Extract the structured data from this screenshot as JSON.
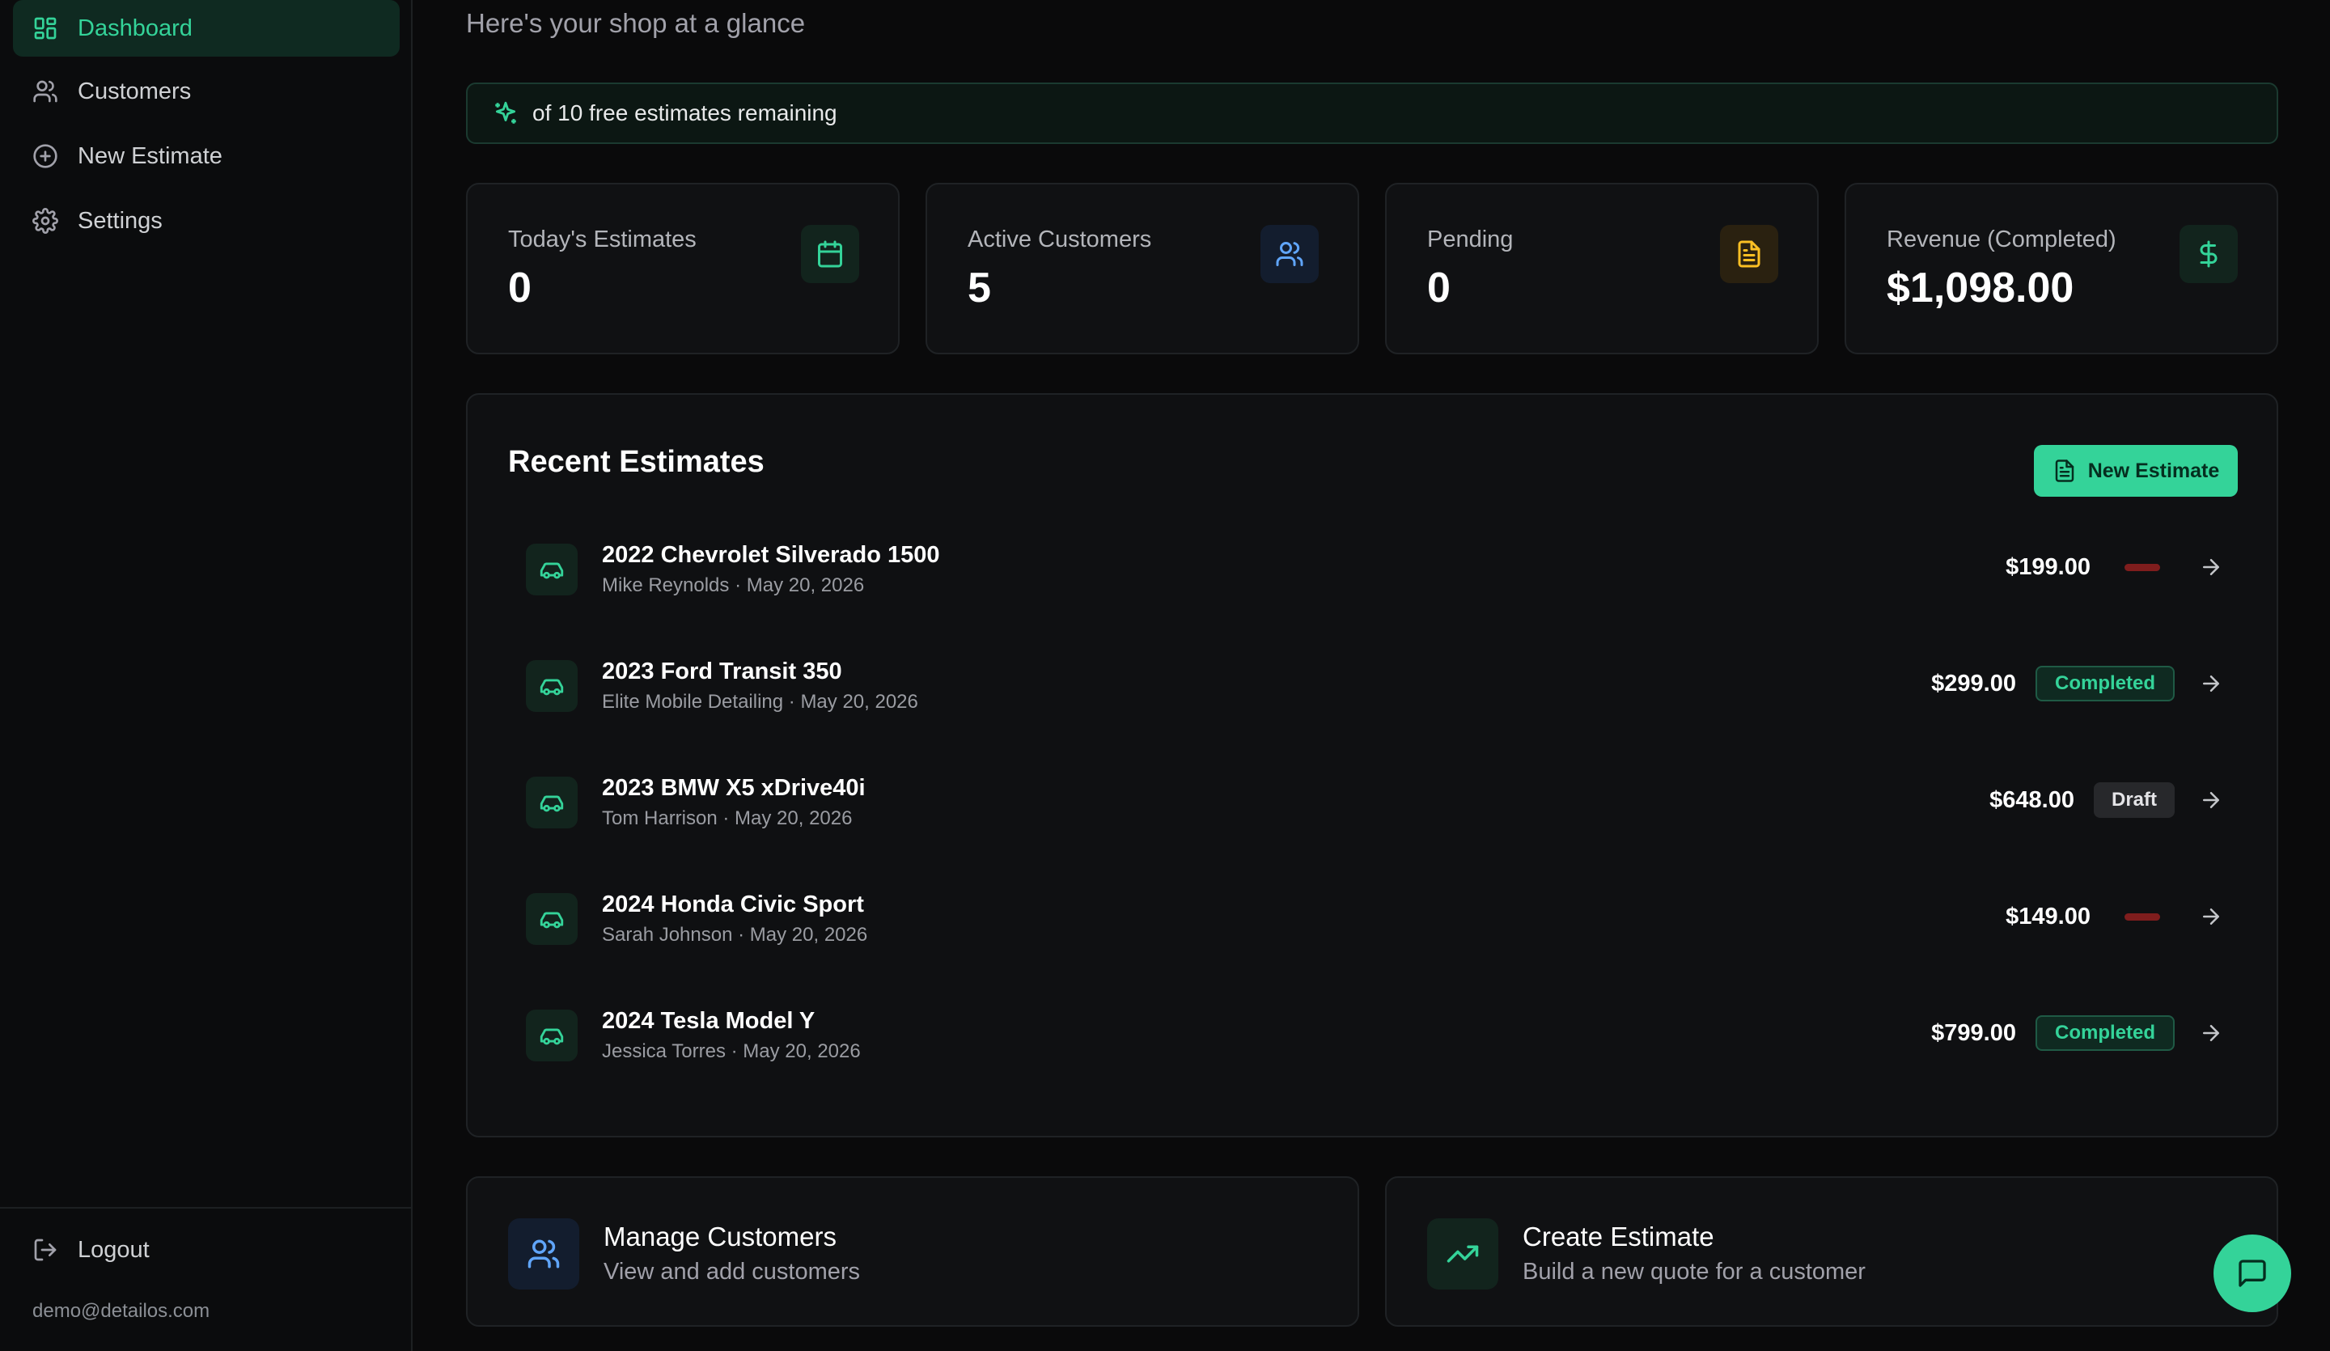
{
  "sidebar": {
    "items": [
      {
        "label": "Dashboard",
        "icon": "dashboard-icon",
        "active": true
      },
      {
        "label": "Customers",
        "icon": "users-icon"
      },
      {
        "label": "New Estimate",
        "icon": "plus-circle-icon"
      },
      {
        "label": "Settings",
        "icon": "gear-icon"
      }
    ],
    "logout_label": "Logout",
    "user_email": "demo@detailos.com"
  },
  "main": {
    "greeting": "Here's your shop at a glance",
    "banner_text": "of 10 free estimates remaining",
    "stats": [
      {
        "label": "Today's Estimates",
        "value": "0",
        "icon": "calendar-icon",
        "color": "#34d399"
      },
      {
        "label": "Active Customers",
        "value": "5",
        "icon": "users-icon",
        "color": "#60a5fa"
      },
      {
        "label": "Pending",
        "value": "0",
        "icon": "document-icon",
        "color": "#fbbf24"
      },
      {
        "label": "Revenue (Completed)",
        "value": "$1,098.00",
        "icon": "dollar-icon",
        "color": "#34d399"
      }
    ],
    "recent": {
      "title": "Recent Estimates",
      "new_button_label": "New Estimate",
      "rows": [
        {
          "vehicle": "2022 Chevrolet Silverado 1500",
          "customer": "Mike Reynolds",
          "date": "May 20, 2026",
          "price": "$199.00",
          "status": ""
        },
        {
          "vehicle": "2023 Ford Transit 350",
          "customer": "Elite Mobile Detailing",
          "date": "May 20, 2026",
          "price": "$299.00",
          "status": "Completed"
        },
        {
          "vehicle": "2023 BMW X5 xDrive40i",
          "customer": "Tom Harrison",
          "date": "May 20, 2026",
          "price": "$648.00",
          "status": "Draft"
        },
        {
          "vehicle": "2024 Honda Civic Sport",
          "customer": "Sarah Johnson",
          "date": "May 20, 2026",
          "price": "$149.00",
          "status": ""
        },
        {
          "vehicle": "2024 Tesla Model Y",
          "customer": "Jessica Torres",
          "date": "May 20, 2026",
          "price": "$799.00",
          "status": "Completed"
        }
      ],
      "row_separator": " · "
    },
    "actions": [
      {
        "title": "Manage Customers",
        "subtitle": "View and add customers",
        "icon": "users-icon",
        "color": "#60a5fa"
      },
      {
        "title": "Create Estimate",
        "subtitle": "Build a new quote for a customer",
        "icon": "trending-up-icon",
        "color": "#34d399"
      }
    ]
  },
  "colors": {
    "accent": "#34d399",
    "background": "#0a0a0b",
    "card": "#101113",
    "danger": "#7f1d1d"
  }
}
